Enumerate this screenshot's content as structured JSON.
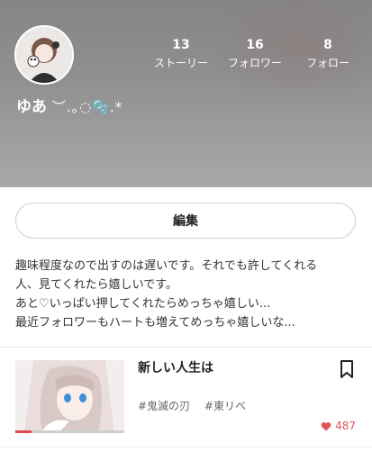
{
  "profile": {
    "username": "ゆあ",
    "username_decoration": "︶.｡◌🫧.*",
    "stats": [
      {
        "value": "13",
        "label": "ストーリー"
      },
      {
        "value": "16",
        "label": "フォロワー"
      },
      {
        "value": "8",
        "label": "フォロー"
      }
    ],
    "edit_label": "編集",
    "bio_lines": [
      "趣味程度なので出すのは遅いです。それでも許してくれる",
      "人、見てくれたら嬉しいです。",
      "あと♡いっぱい押してくれたらめっちゃ嬉しい...",
      "最近フォロワーもハートも増えてめっちゃ嬉しいな..."
    ]
  },
  "stories": [
    {
      "title": "新しい人生は",
      "tags": [
        "#鬼滅の刃",
        "#東リベ"
      ],
      "likes": "487",
      "read_progress": 0.15
    }
  ],
  "colors": {
    "accent": "#e05555",
    "header_gray": "#8f8f8f"
  },
  "icons": {
    "bookmark": "bookmark-icon",
    "heart": "heart-icon"
  }
}
